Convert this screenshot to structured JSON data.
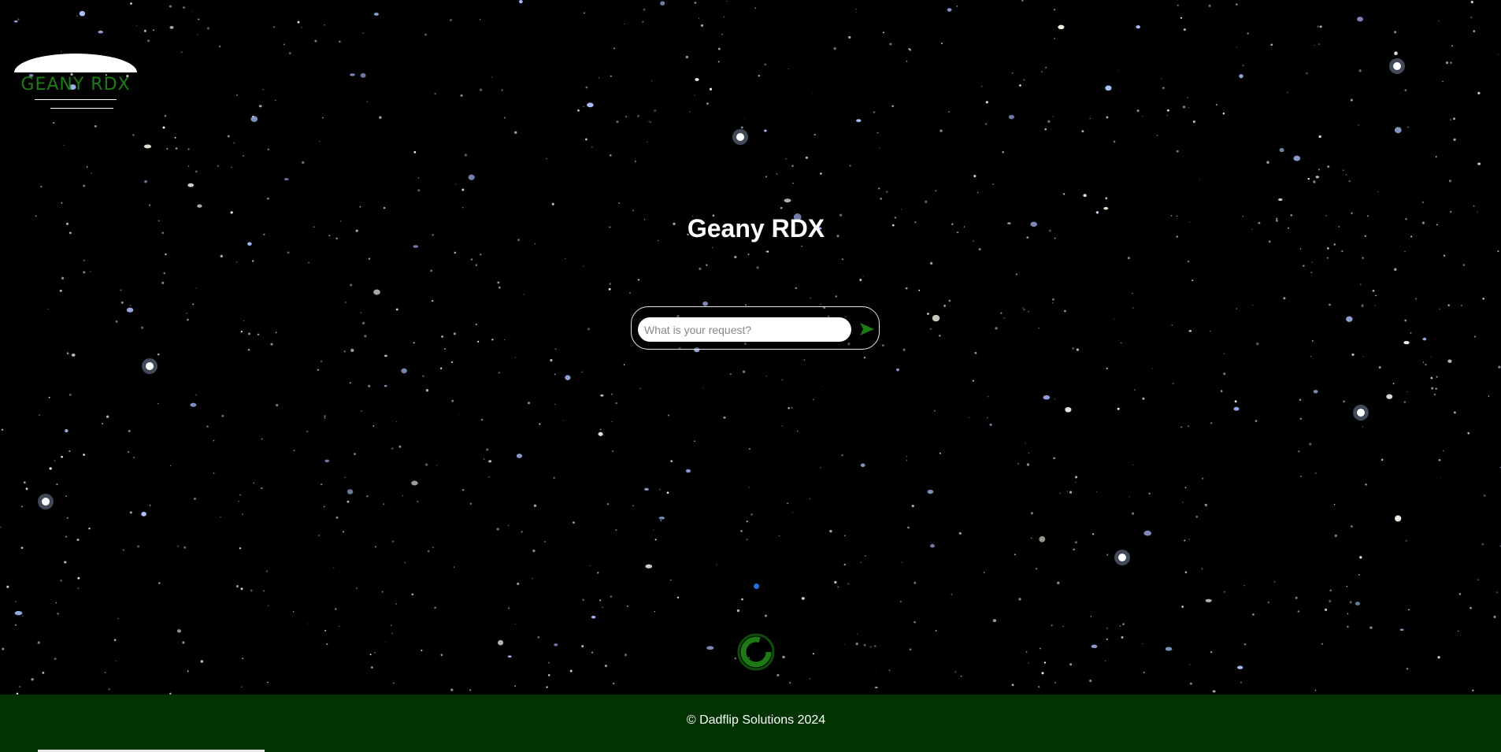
{
  "logo": {
    "text": "GEANY RDX",
    "icon": "dome-logo-icon"
  },
  "main": {
    "title": "Geany RDX"
  },
  "search": {
    "placeholder": "What is your request?",
    "value": "",
    "send_icon": "send-arrow-icon"
  },
  "status": {
    "dot_icon": "status-dot-icon",
    "spinner_icon": "loading-spinner-icon"
  },
  "footer": {
    "copyright": "© Dadflip Solutions 2024"
  },
  "colors": {
    "background": "#000000",
    "accent_green": "#1e7a14",
    "footer_bg": "#003300",
    "dot_blue": "#1a73e8",
    "text_white": "#ffffff"
  }
}
